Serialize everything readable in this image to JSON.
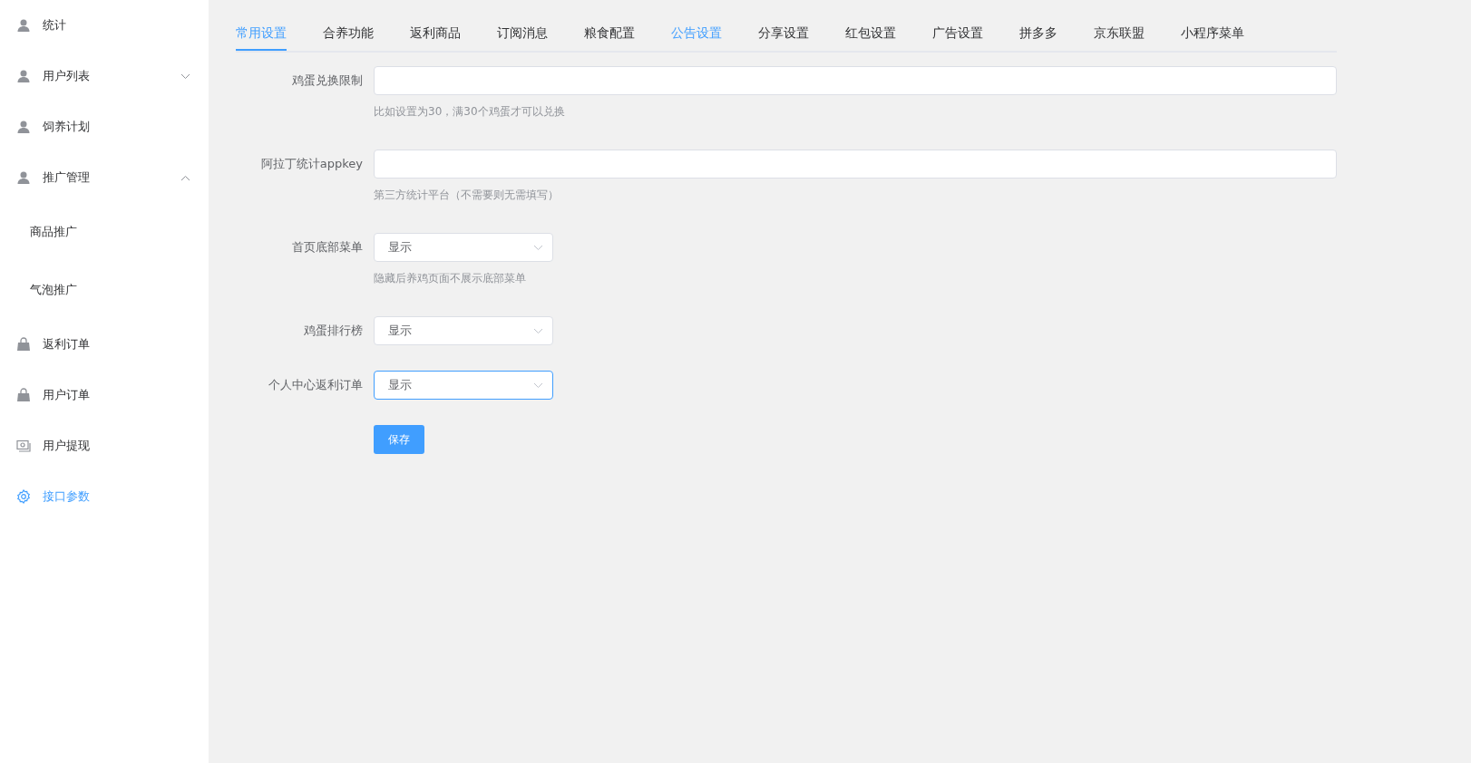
{
  "sidebar": {
    "items": [
      {
        "label": "统计",
        "kind": "person",
        "selected": false
      },
      {
        "label": "用户列表",
        "kind": "person",
        "selected": false,
        "expanded": false
      },
      {
        "label": "饲养计划",
        "kind": "person",
        "selected": false
      },
      {
        "label": "推广管理",
        "kind": "person",
        "selected": false,
        "expanded": true,
        "children": [
          {
            "label": "商品推广",
            "selected": false
          },
          {
            "label": "气泡推广",
            "selected": false
          }
        ]
      },
      {
        "label": "返利订单",
        "kind": "bag",
        "selected": false
      },
      {
        "label": "用户订单",
        "kind": "bag",
        "selected": false
      },
      {
        "label": "用户提现",
        "kind": "money",
        "selected": false
      },
      {
        "label": "接口参数",
        "kind": "gear",
        "selected": true
      }
    ]
  },
  "tabs": [
    {
      "label": "常用设置",
      "selected": true,
      "hovered": false
    },
    {
      "label": "合养功能",
      "selected": false,
      "hovered": false
    },
    {
      "label": "返利商品",
      "selected": false,
      "hovered": false
    },
    {
      "label": "订阅消息",
      "selected": false,
      "hovered": false
    },
    {
      "label": "粮食配置",
      "selected": false,
      "hovered": false
    },
    {
      "label": "公告设置",
      "selected": false,
      "hovered": true
    },
    {
      "label": "分享设置",
      "selected": false,
      "hovered": false
    },
    {
      "label": "红包设置",
      "selected": false,
      "hovered": false
    },
    {
      "label": "广告设置",
      "selected": false,
      "hovered": false
    },
    {
      "label": "拼多多",
      "selected": false,
      "hovered": false
    },
    {
      "label": "京东联盟",
      "selected": false,
      "hovered": false
    },
    {
      "label": "小程序菜单",
      "selected": false,
      "hovered": false
    }
  ],
  "form": {
    "fields": [
      {
        "kind": "text",
        "label": "鸡蛋兑换限制",
        "hint": "比如设置为30，满30个鸡蛋才可以兑换",
        "focused": false
      },
      {
        "kind": "text",
        "label": "阿拉丁统计appkey",
        "hint": "第三方统计平台（不需要则无需填写）",
        "focused": false
      },
      {
        "kind": "select",
        "label": "首页底部菜单",
        "value": "显示",
        "hint": "隐藏后养鸡页面不展示底部菜单",
        "focused": false
      },
      {
        "kind": "select",
        "label": "鸡蛋排行榜",
        "value": "显示",
        "focused": false
      },
      {
        "kind": "select",
        "label": "个人中心返利订单",
        "value": "显示",
        "focused": true
      }
    ],
    "save_button": "保存"
  }
}
